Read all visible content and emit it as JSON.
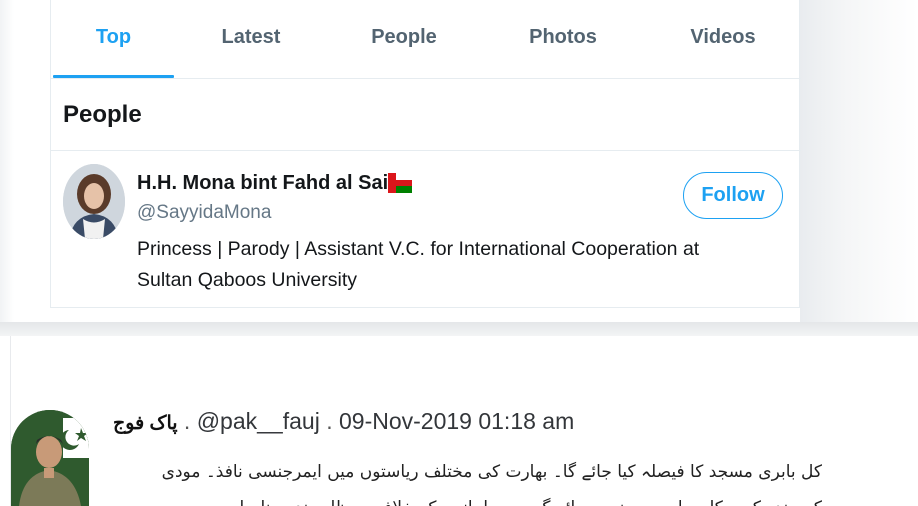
{
  "tabs": [
    {
      "label": "Top",
      "active": true
    },
    {
      "label": "Latest",
      "active": false
    },
    {
      "label": "People",
      "active": false
    },
    {
      "label": "Photos",
      "active": false
    },
    {
      "label": "Videos",
      "active": false
    }
  ],
  "section": {
    "title": "People"
  },
  "user": {
    "name": "H.H. Mona bint Fahd al Said",
    "flag": "oman-flag-icon",
    "handle": "@SayyidaMona",
    "bio": "Princess | Parody | Assistant V.C. for International Cooperation at Sultan Qaboos University",
    "follow_label": "Follow"
  },
  "tweet": {
    "author_name": "پاک فوج",
    "separator1": " . ",
    "handle": "@pak__fauj",
    "separator2": " . ",
    "timestamp": "09-Nov-2019 01:18 am",
    "text_line1": "کل بابری مسجد کا فیصلہ کیا جائے گا۔ بھارت کی مختلف ریاستوں میں ایمرجنسی نافذ۔ مودی",
    "text_line2": "کے ہندو کی مکاری اب بھی نہیں جائے گی۔ مسلمانوں کے خلاف یہ ظلم بند ہونا چاہیے"
  },
  "colors": {
    "accent": "#1da1f2",
    "text": "#14171a",
    "muted": "#657786",
    "border": "#e6ecf0"
  }
}
